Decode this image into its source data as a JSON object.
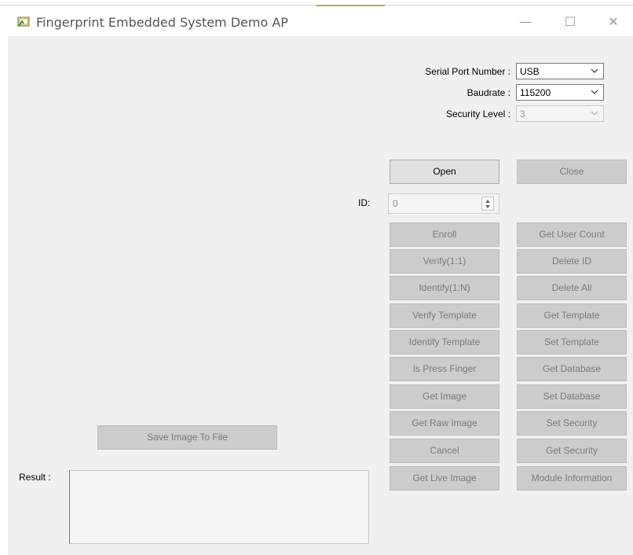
{
  "window": {
    "title": "Fingerprint Embedded System Demo AP",
    "controls": {
      "minimize": "—",
      "maximize": "☐",
      "close": "✕"
    },
    "app_icon": "fingerprint-app-icon"
  },
  "settings": {
    "serial_port": {
      "label": "Serial Port Number :",
      "value": "USB"
    },
    "baudrate": {
      "label": "Baudrate :",
      "value": "115200"
    },
    "security_level": {
      "label": "Security Level :",
      "value": "3"
    }
  },
  "connection": {
    "open": "Open",
    "close": "Close"
  },
  "id_field": {
    "label": "ID:",
    "value": "0"
  },
  "commands_left": [
    "Enroll",
    "Verify(1:1)",
    "Identify(1:N)",
    "Verify Template",
    "Identify Template",
    "Is Press Finger",
    "Get Image",
    "Get Raw Image",
    "Cancel",
    "Get Live Image"
  ],
  "commands_right": [
    "Get User Count",
    "Delete ID",
    "Delete All",
    "Get Template",
    "Set Template",
    "Get Database",
    "Set Database",
    "Set Security",
    "Get Security",
    "Module Information"
  ],
  "save_image": "Save Image To File",
  "result": {
    "label": "Result :",
    "text": ""
  },
  "colors": {
    "client_bg": "#f0f0f0",
    "button_disabled": "#cccccc",
    "button_enabled": "#e1e1e1",
    "accent": "#c9a24a"
  }
}
